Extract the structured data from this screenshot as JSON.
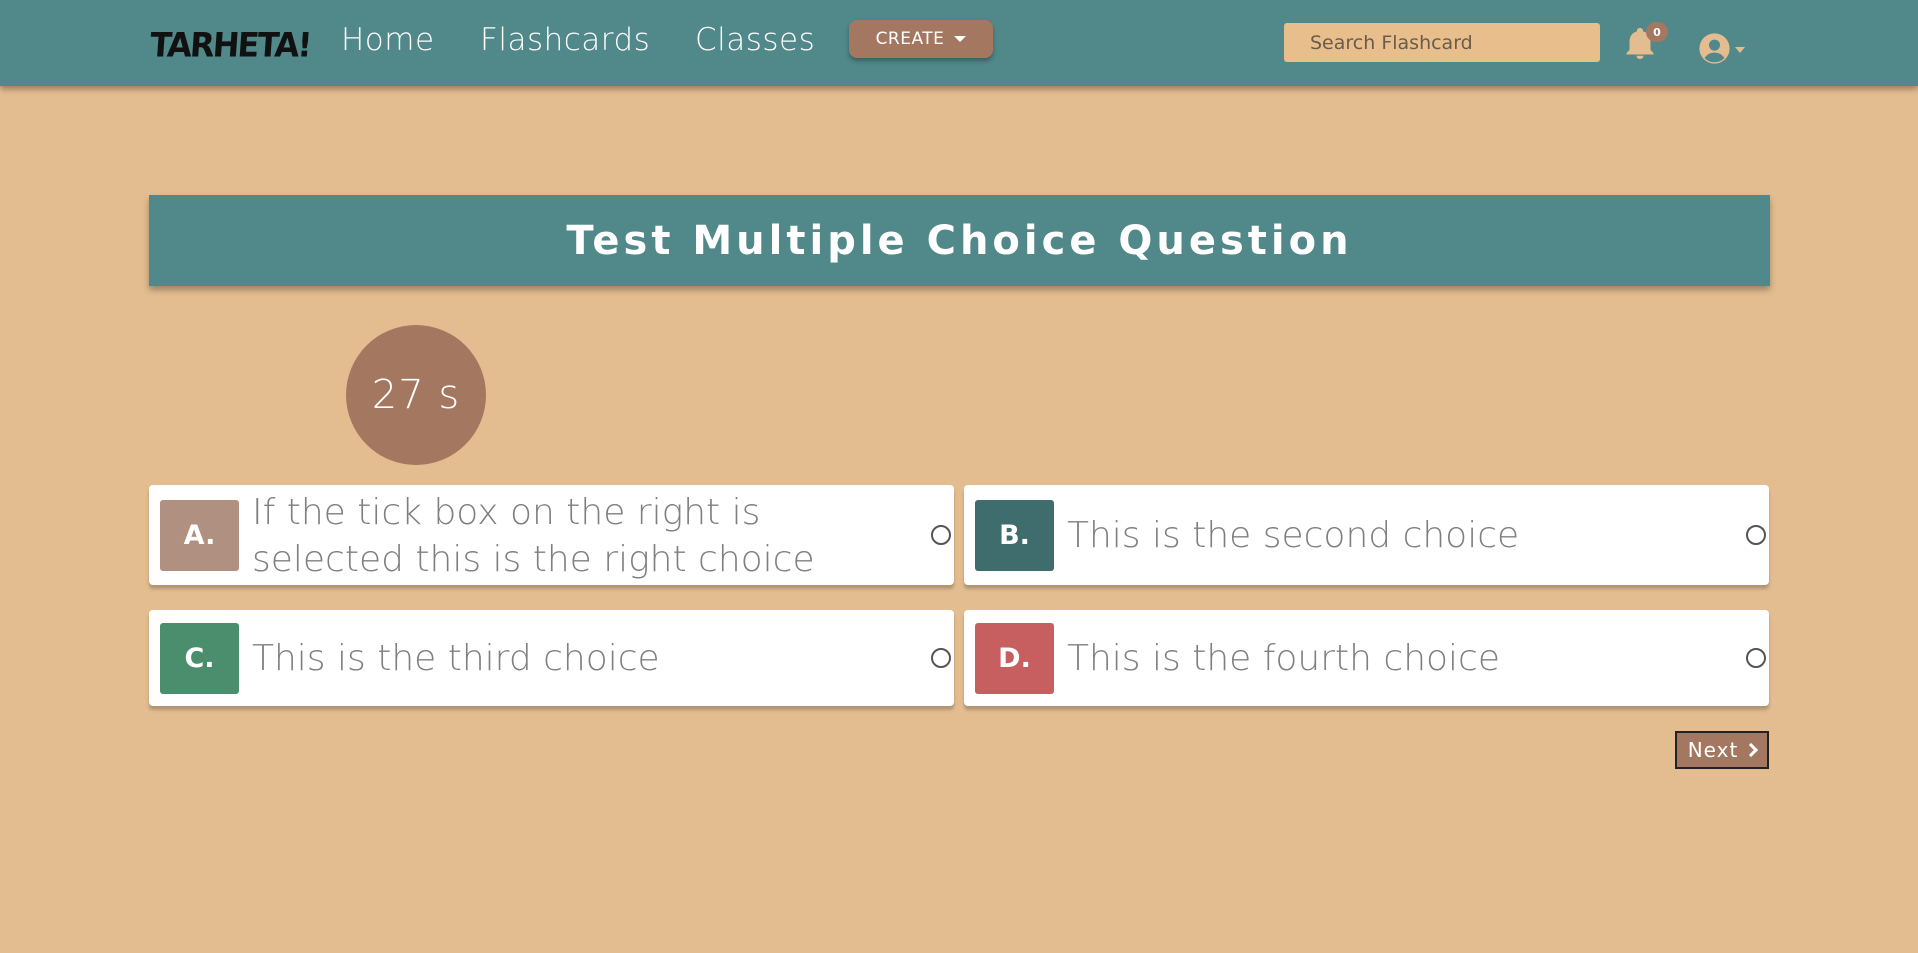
{
  "nav": {
    "logo": "TARHETA!",
    "links": [
      "Home",
      "Flashcards",
      "Classes"
    ],
    "create_label": "CREATE",
    "search_placeholder": "Search Flashcard",
    "notification_count": "0"
  },
  "quiz": {
    "title": "Test Multiple Choice Question",
    "timer": "27 s",
    "choices": [
      {
        "letter": "A.",
        "text": "If the tick box on the right is selected this is the right choice",
        "color": "#b09080"
      },
      {
        "letter": "B.",
        "text": "This is the second choice",
        "color": "#3f6d6e"
      },
      {
        "letter": "C.",
        "text": "This is the third choice",
        "color": "#4b8e6e"
      },
      {
        "letter": "D.",
        "text": "This is the fourth choice",
        "color": "#c75e5f"
      }
    ],
    "next_label": "Next"
  },
  "colors": {
    "page_bg": "#e3bd90",
    "navbar": "#51888a",
    "accent": "#a47761"
  }
}
